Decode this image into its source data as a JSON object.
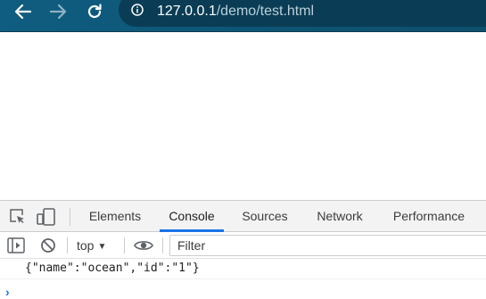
{
  "browser": {
    "nav": {
      "back_icon": "arrow-left-icon",
      "forward_icon": "arrow-right-icon",
      "reload_icon": "reload-icon"
    },
    "omnibox": {
      "icon": "info-icon",
      "url_host": "127.0.0.1",
      "url_path": "/demo/test.html"
    },
    "colors": {
      "toolbar": "#0f5d80",
      "omnibox": "#0a3d55",
      "accent": "#1a73e8"
    }
  },
  "devtools": {
    "toolbar_icons": [
      "inspect-element-icon",
      "device-toggle-icon"
    ],
    "tabs": [
      {
        "label": "Elements"
      },
      {
        "label": "Console",
        "active": true
      },
      {
        "label": "Sources"
      },
      {
        "label": "Network"
      },
      {
        "label": "Performance"
      }
    ],
    "console_toolbar": {
      "sidebar_icon": "sidebar-toggle-icon",
      "clear_icon": "clear-console-icon",
      "context": "top",
      "live_expression_icon": "eye-icon",
      "filter_placeholder": "Filter"
    },
    "console": {
      "lines": [
        "{\"name\":\"ocean\",\"id\":\"1\"}"
      ],
      "prompt_icon": "console-prompt-icon"
    }
  }
}
